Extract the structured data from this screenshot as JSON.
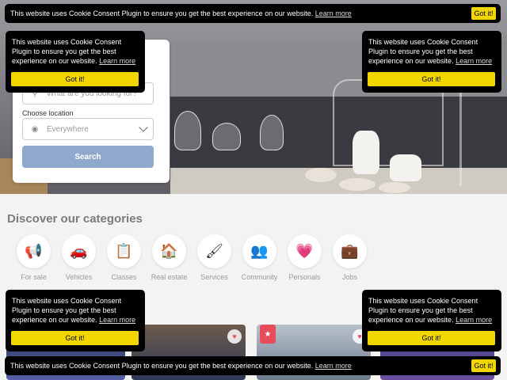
{
  "search": {
    "query_placeholder": "What are you looking for?",
    "location_label": "Choose location",
    "location_value": "Everywhere",
    "search_button": "Search"
  },
  "categories": {
    "title": "Discover our categories",
    "items": [
      {
        "label": "For sale",
        "icon": "megaphone-icon",
        "glyph": "📢"
      },
      {
        "label": "Vehicles",
        "icon": "car-icon",
        "glyph": "🚗"
      },
      {
        "label": "Classes",
        "icon": "chalkboard-icon",
        "glyph": "📋"
      },
      {
        "label": "Real estate",
        "icon": "house-icon",
        "glyph": "🏠"
      },
      {
        "label": "Services",
        "icon": "paint-roller-icon",
        "glyph": "🖌"
      },
      {
        "label": "Community",
        "icon": "people-icon",
        "glyph": "👥"
      },
      {
        "label": "Personals",
        "icon": "heart-magnifier-icon",
        "glyph": "💗"
      },
      {
        "label": "Jobs",
        "icon": "briefcase-icon",
        "glyph": "💼"
      }
    ]
  },
  "cookie": {
    "message": "This website uses Cookie Consent Plugin to ensure you get the best experience on our website.",
    "learn_more": "Learn more",
    "got_it": "Got it!"
  },
  "colors": {
    "accent_yellow": "#f1d600",
    "search_button": "#8fa8cc",
    "badge_red": "#e74c5a"
  }
}
